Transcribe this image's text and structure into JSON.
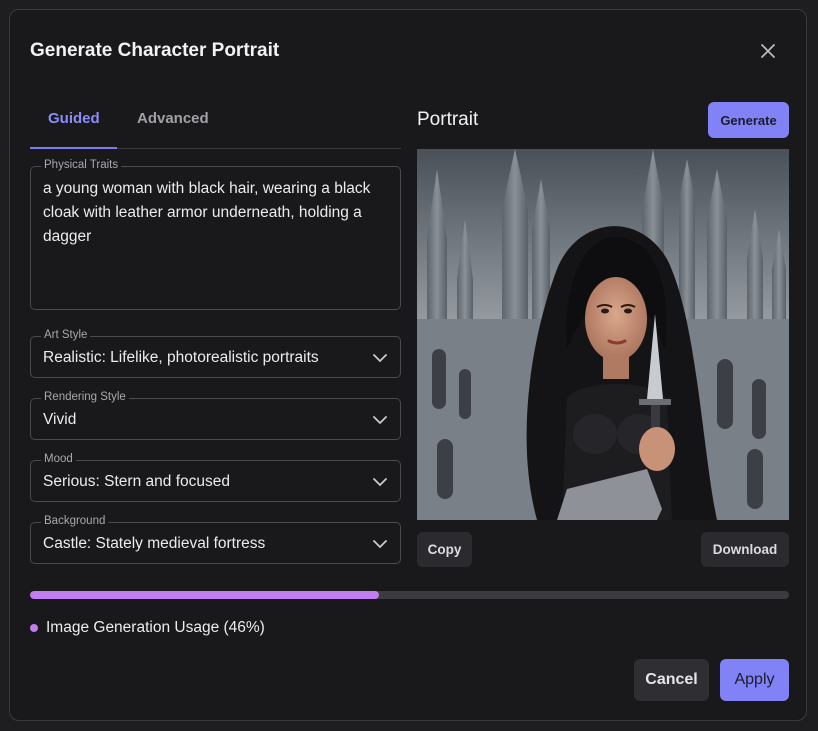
{
  "dialog": {
    "title": "Generate Character Portrait",
    "close_icon": "close-icon"
  },
  "tabs": [
    {
      "label": "Guided",
      "active": true
    },
    {
      "label": "Advanced",
      "active": false
    }
  ],
  "fields": {
    "physical_traits": {
      "label": "Physical Traits",
      "value": "a young woman with black hair, wearing a black cloak with leather armor underneath, holding a dagger"
    },
    "art_style": {
      "label": "Art Style",
      "value": "Realistic: Lifelike, photorealistic portraits"
    },
    "rendering_style": {
      "label": "Rendering Style",
      "value": "Vivid"
    },
    "mood": {
      "label": "Mood",
      "value": "Serious: Stern and focused"
    },
    "background": {
      "label": "Background",
      "value": "Castle: Stately medieval fortress"
    }
  },
  "portrait": {
    "title": "Portrait",
    "generate_label": "Generate",
    "copy_label": "Copy",
    "download_label": "Download"
  },
  "usage": {
    "label": "Image Generation Usage (46%)",
    "percent": 46
  },
  "footer": {
    "cancel_label": "Cancel",
    "apply_label": "Apply"
  },
  "colors": {
    "accent": "#8082f6",
    "progress": "#c07ef0",
    "background": "#19191b"
  }
}
